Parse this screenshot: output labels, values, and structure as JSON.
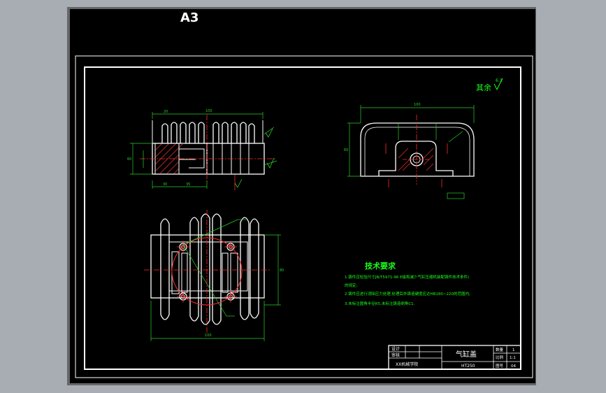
{
  "sheet": {
    "size_label": "A3",
    "background": "#000000",
    "chrome_color": "#a7adb3"
  },
  "colors": {
    "outline": "#ffffff",
    "dimension": "#2ad12a",
    "center_line": "#ff2a2a",
    "hatch": "#ff3030",
    "annotation": "#1aff1a",
    "text_blue": "#4e6cff"
  },
  "annotations": {
    "roughness_other": "其余",
    "roughness_value": "6.3"
  },
  "tech_requirements": {
    "heading": "技术要求",
    "lines": [
      "1.铸件应检验尺寸JB/T5971-96 E级和减少气缸压缩机装配铸件技术条件)",
      "的规定;",
      "2.铸件应进行消除应力处理,处理后外铸造硬度应达HB180~220的范围内;",
      "3.未标注圆角半径R5,未标注铸造倒角C1."
    ]
  },
  "title_block": {
    "part_name": "气缸盖",
    "material": "HT250",
    "designer_label": "设计",
    "checker_label": "审核",
    "scale_label": "比例",
    "scale_value": "1:1",
    "qty_label": "数量",
    "qty_value": "1",
    "sheet_label": "图号",
    "sheet_value": "04",
    "company": "XX机械学院"
  },
  "dimensions": {
    "top_overall": "100",
    "right_width": "100",
    "bottom_overall": "100",
    "left_height": "60",
    "right_height": "80",
    "small_1": "30",
    "small_2": "20",
    "small_3": "35"
  }
}
